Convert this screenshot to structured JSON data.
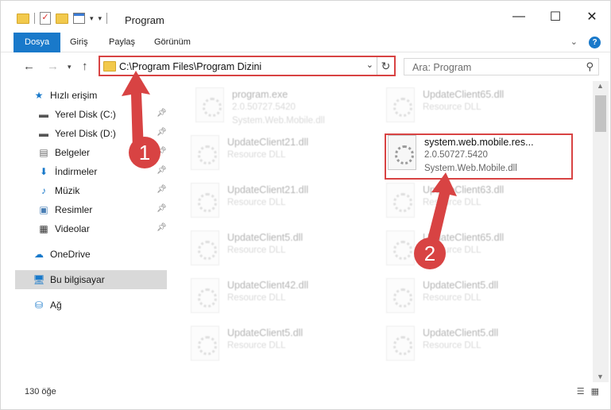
{
  "window": {
    "title": "Program"
  },
  "ribbon": {
    "tabs": [
      "Dosya",
      "Giriş",
      "Paylaş",
      "Görünüm"
    ]
  },
  "address": {
    "path": "C:\\Program Files\\Program Dizini"
  },
  "search": {
    "placeholder": "Ara: Program"
  },
  "sidebar": {
    "items": [
      {
        "label": "Hızlı erişim",
        "icon": "star-icon"
      },
      {
        "label": "Yerel Disk (C:)",
        "icon": "drive-icon",
        "pinned": true
      },
      {
        "label": "Yerel Disk (D:)",
        "icon": "drive-icon",
        "pinned": true
      },
      {
        "label": "Belgeler",
        "icon": "documents-icon",
        "pinned": true
      },
      {
        "label": "İndirmeler",
        "icon": "download-icon",
        "pinned": true
      },
      {
        "label": "Müzik",
        "icon": "music-icon",
        "pinned": true
      },
      {
        "label": "Resimler",
        "icon": "pictures-icon",
        "pinned": true
      },
      {
        "label": "Videolar",
        "icon": "videos-icon",
        "pinned": true
      },
      {
        "label": "OneDrive",
        "icon": "cloud-icon"
      },
      {
        "label": "Bu bilgisayar",
        "icon": "computer-icon",
        "selected": true
      },
      {
        "label": "Ağ",
        "icon": "network-icon"
      }
    ]
  },
  "files": [
    {
      "name": "program.exe",
      "line2": "2.0.50727.5420",
      "line3": "System.Web.Mobile.dll"
    },
    {
      "name": "UpdateClient65.dll",
      "line2": "Resource DLL"
    },
    {
      "name": "UpdateClient21.dll",
      "line2": "Resource DLL"
    },
    {
      "name": "system.web.mobile.res...",
      "line2": "2.0.50727.5420",
      "line3": "System.Web.Mobile.dll"
    },
    {
      "name": "UpdateClient21.dll",
      "line2": "Resource DLL"
    },
    {
      "name": "UpdateClient63.dll",
      "line2": "Resource DLL"
    },
    {
      "name": "UpdateClient5.dll",
      "line2": "Resource DLL"
    },
    {
      "name": "UpdateClient65.dll",
      "line2": "Resource DLL"
    },
    {
      "name": "UpdateClient42.dll",
      "line2": "Resource DLL"
    },
    {
      "name": "UpdateClient5.dll",
      "line2": "Resource DLL"
    },
    {
      "name": "UpdateClient5.dll",
      "line2": "Resource DLL"
    },
    {
      "name": "UpdateClient5.dll",
      "line2": "Resource DLL"
    }
  ],
  "status": {
    "count": "130 öğe"
  },
  "annotations": {
    "badge1": "1",
    "badge2": "2"
  },
  "colors": {
    "accent": "#1979ca",
    "highlight": "#d84343"
  }
}
